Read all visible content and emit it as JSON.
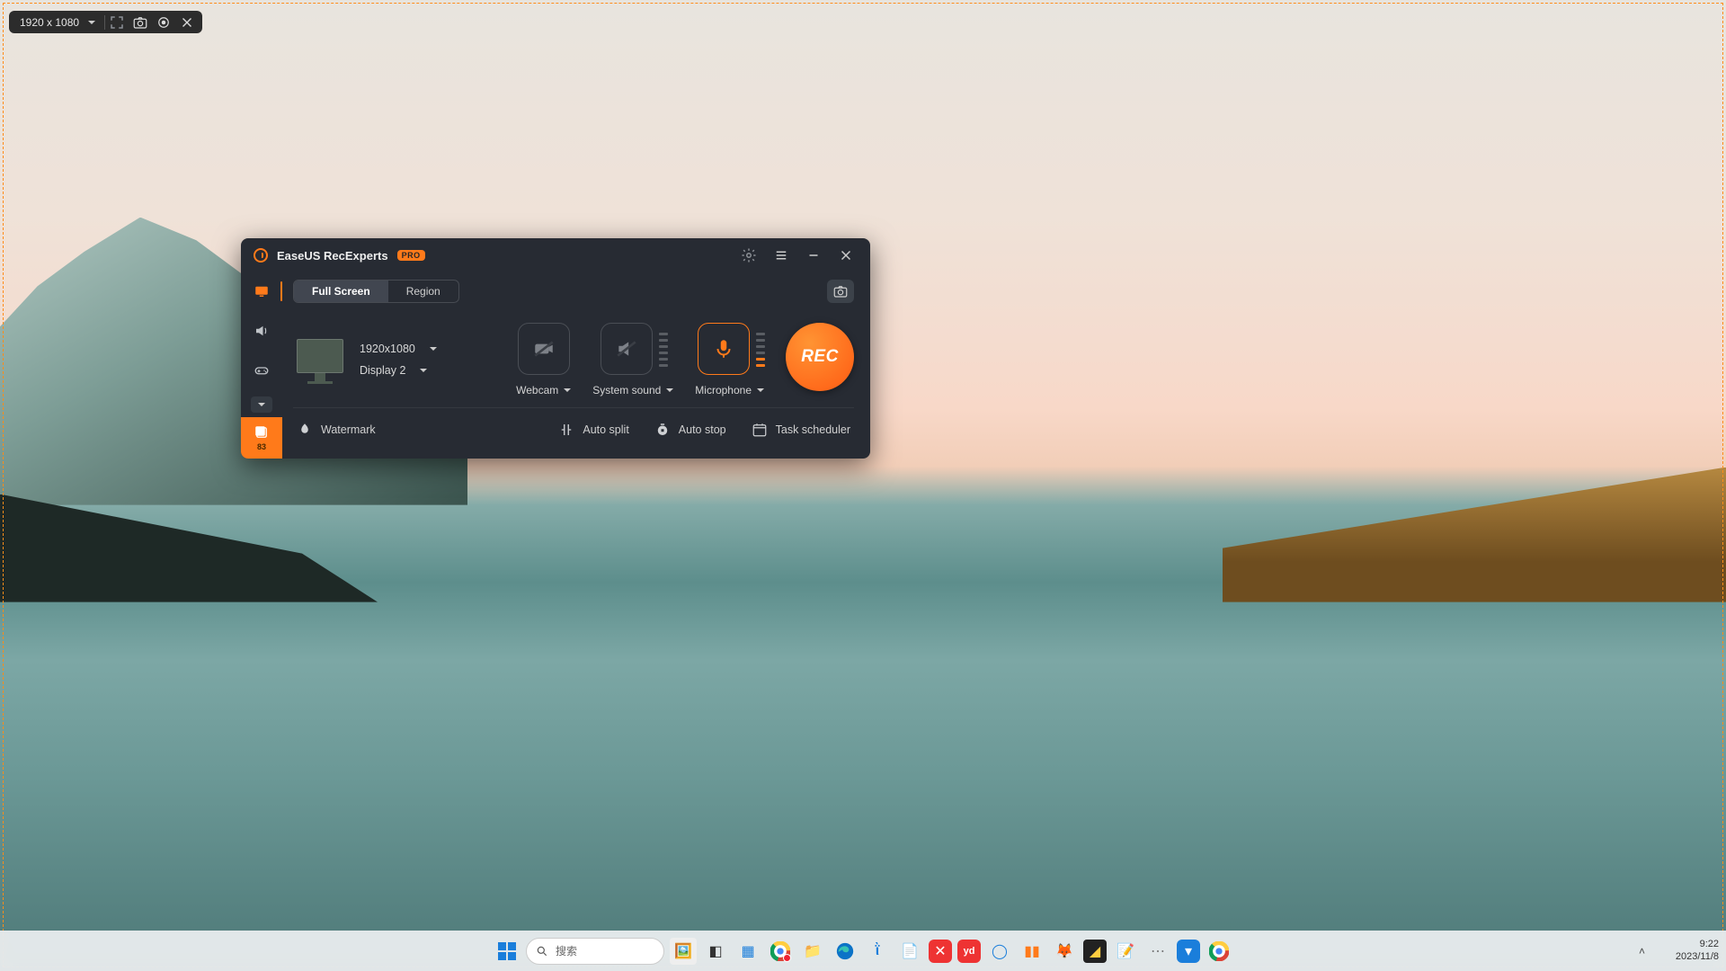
{
  "capture_bar": {
    "size_label": "1920 x 1080"
  },
  "app": {
    "title": "EaseUS RecExperts",
    "badge": "PRO",
    "tabs": {
      "full_screen": "Full Screen",
      "region": "Region"
    },
    "resolution": "1920x1080",
    "display": "Display 2",
    "sources": {
      "webcam": "Webcam",
      "system_sound": "System sound",
      "microphone": "Microphone"
    },
    "rec": "REC",
    "sidebar_gallery_count": "83",
    "bottom": {
      "watermark": "Watermark",
      "auto_split": "Auto split",
      "auto_stop": "Auto stop",
      "task_scheduler": "Task scheduler"
    }
  },
  "taskbar": {
    "search_placeholder": "搜索",
    "time": "9:22",
    "date": "2023/11/8"
  }
}
